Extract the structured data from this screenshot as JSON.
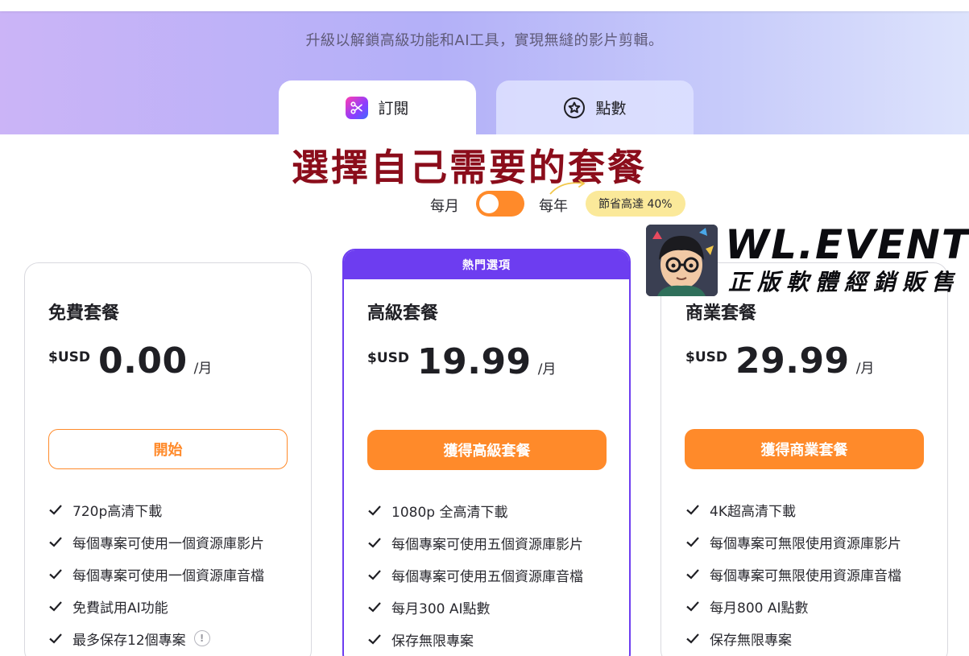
{
  "header": {
    "subtitle": "升級以解鎖高級功能和AI工具，實現無縫的影片剪輯。"
  },
  "tabs": [
    {
      "label": "訂閱",
      "icon": "scissors-icon",
      "active": true
    },
    {
      "label": "點數",
      "icon": "star-icon",
      "active": false
    }
  ],
  "overlay": {
    "title": "選擇自己需要的套餐"
  },
  "billing": {
    "monthly_label": "每月",
    "yearly_label": "每年",
    "save_badge": "節省高達 40%",
    "toggle_on": true
  },
  "plans": [
    {
      "name": "免費套餐",
      "currency": "$USD",
      "price": "0.00",
      "period": "/月",
      "cta": "開始",
      "features": [
        "720p高清下載",
        "每個專案可使用一個資源庫影片",
        "每個專案可使用一個資源庫音檔",
        "免費試用AI功能",
        "最多保存12個專案"
      ]
    },
    {
      "badge": "熱門選項",
      "name": "高級套餐",
      "currency": "$USD",
      "price": "19.99",
      "period": "/月",
      "cta": "獲得高級套餐",
      "features": [
        "1080p 全高清下載",
        "每個專案可使用五個資源庫影片",
        "每個專案可使用五個資源庫音檔",
        "每月300 AI點數",
        "保存無限專案"
      ]
    },
    {
      "name": "商業套餐",
      "currency": "$USD",
      "price": "29.99",
      "period": "/月",
      "cta": "獲得商業套餐",
      "features": [
        "4K超高清下載",
        "每個專案可無限使用資源庫影片",
        "每個專案可無限使用資源庫音檔",
        "每月800 AI點數",
        "保存無限專案"
      ]
    }
  ],
  "watermark": {
    "brand": "WL.EVENT",
    "tagline": "正版軟體經銷販售"
  },
  "colors": {
    "accent_orange": "#ff8a2a",
    "accent_purple": "#6d3df0",
    "overlay_red": "#8b0d1b",
    "badge_yellow": "#fbe99a"
  }
}
